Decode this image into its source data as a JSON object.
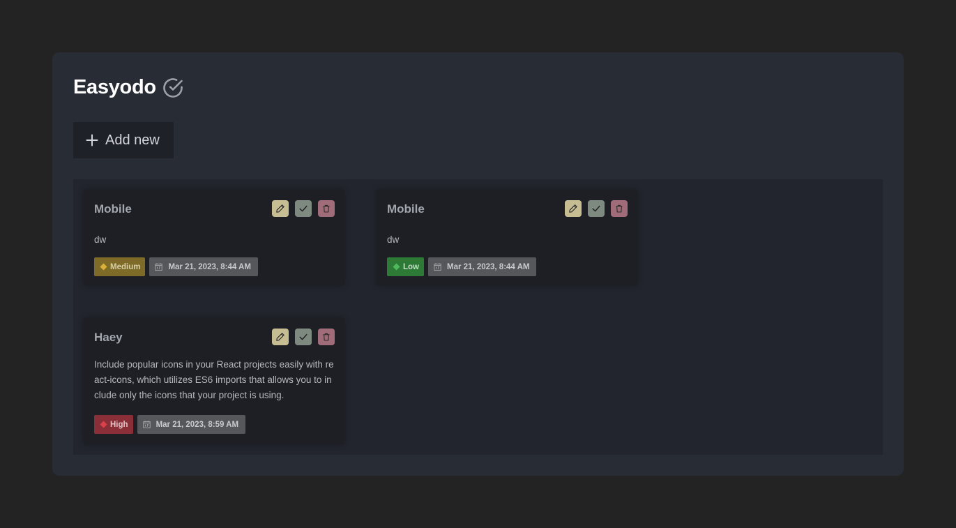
{
  "app": {
    "title": "Easyodo",
    "title_icon": "check-circle-icon"
  },
  "toolbar": {
    "add_label": "Add new",
    "add_icon": "plus-icon"
  },
  "actions": {
    "edit_icon": "pencil-icon",
    "complete_icon": "check-icon",
    "delete_icon": "trash-icon"
  },
  "colors": {
    "background": "#232323",
    "panel": "#282c35",
    "medium": "#7e6b28",
    "low": "#2d7a36",
    "high": "#8a2f37",
    "edit": "#c7bd93",
    "complete": "#7e8a80",
    "delete": "#a16c79"
  },
  "todos": [
    {
      "title": "Mobile",
      "description": "dw",
      "priority": "Medium",
      "priority_icon": "diamond-icon",
      "date": "Mar 21, 2023, 8:44 AM",
      "date_icon": "calendar-icon"
    },
    {
      "title": "Mobile",
      "description": "dw",
      "priority": "Low",
      "priority_icon": "diamond-icon",
      "date": "Mar 21, 2023, 8:44 AM",
      "date_icon": "calendar-icon"
    },
    {
      "title": "Haey",
      "description": "Include popular icons in your React projects easily with react-icons, which utilizes ES6 imports that allows you to include only the icons that your project is using.",
      "priority": "High",
      "priority_icon": "diamond-icon",
      "date": "Mar 21, 2023, 8:59 AM",
      "date_icon": "calendar-icon"
    }
  ]
}
